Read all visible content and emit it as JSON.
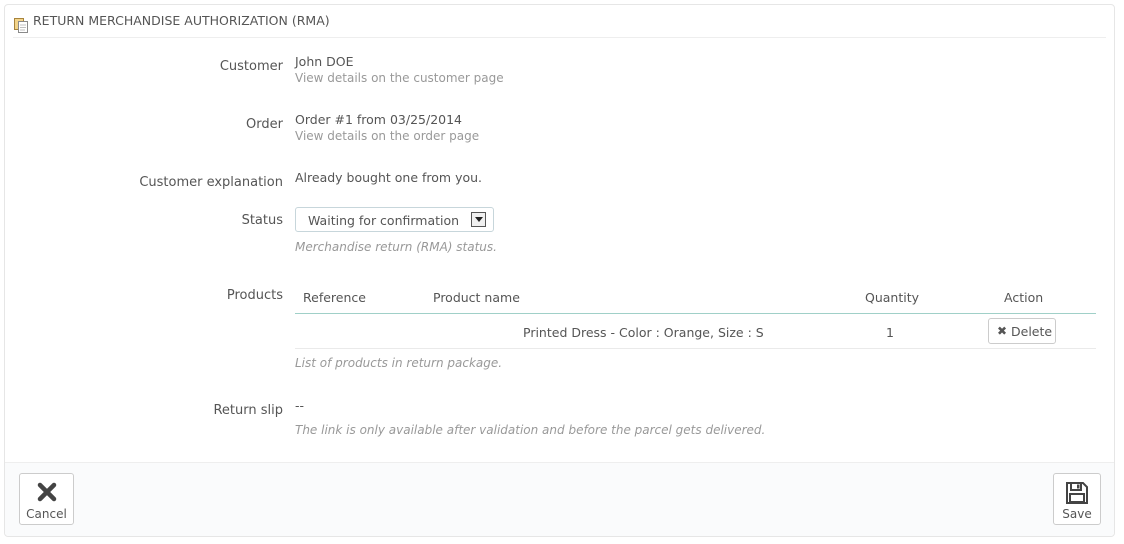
{
  "panel": {
    "title": "RETURN MERCHANDISE AUTHORIZATION (RMA)",
    "icon": "copy-icon"
  },
  "customer": {
    "label": "Customer",
    "name": "John DOE",
    "link": "View details on the customer page"
  },
  "order": {
    "label": "Order",
    "value": "Order #1 from 03/25/2014",
    "link": "View details on the order page"
  },
  "explanation": {
    "label": "Customer explanation",
    "value": "Already bought one from you."
  },
  "status": {
    "label": "Status",
    "selected": "Waiting for confirmation",
    "help": "Merchandise return (RMA) status."
  },
  "products": {
    "label": "Products",
    "columns": [
      "Reference",
      "Product name",
      "Quantity",
      "Action"
    ],
    "rows": [
      {
        "reference": "",
        "name": "Printed Dress - Color : Orange, Size : S",
        "quantity": "1",
        "action": "Delete"
      }
    ],
    "help": "List of products in return package."
  },
  "return_slip": {
    "label": "Return slip",
    "value": "--",
    "help": "The link is only available after validation and before the parcel gets delivered."
  },
  "footer": {
    "cancel_label": "Cancel",
    "save_label": "Save"
  },
  "colors": {
    "muted_text": "#999999",
    "table_header_rule": "#a0d0c8",
    "footer_bg": "#fafbfc"
  }
}
